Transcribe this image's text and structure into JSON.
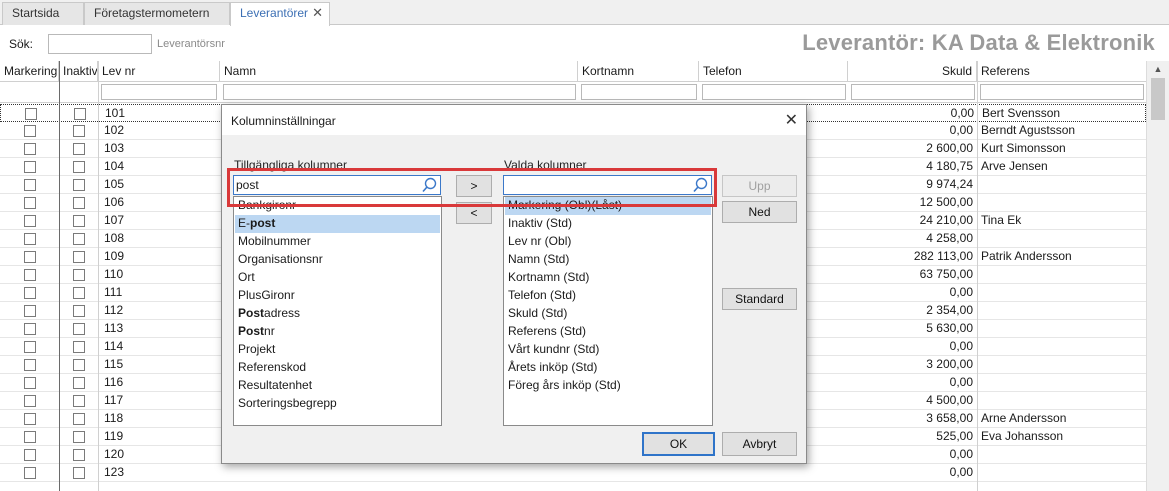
{
  "tabs": [
    {
      "label": "Startsida"
    },
    {
      "label": "Företagstermometern"
    },
    {
      "label": "Leverantörer"
    }
  ],
  "toolbar": {
    "search_label": "Sök:",
    "search_value": "",
    "search_hint": "Leverantörsnr",
    "title": "Leverantör: KA Data & Elektronik"
  },
  "grid": {
    "columns": [
      "Markering",
      "Inaktiv",
      "Lev nr",
      "Namn",
      "Kortnamn",
      "Telefon",
      "Skuld",
      "Referens"
    ],
    "rows": [
      {
        "nr": "101",
        "skuld": "0,00",
        "ref": "Bert Svensson"
      },
      {
        "nr": "102",
        "skuld": "0,00",
        "ref": "Berndt Agustsson"
      },
      {
        "nr": "103",
        "skuld": "2 600,00",
        "ref": "Kurt Simonsson"
      },
      {
        "nr": "104",
        "skuld": "4 180,75",
        "ref": "Arve Jensen"
      },
      {
        "nr": "105",
        "skuld": "9 974,24",
        "ref": ""
      },
      {
        "nr": "106",
        "skuld": "12 500,00",
        "ref": ""
      },
      {
        "nr": "107",
        "skuld": "24 210,00",
        "ref": "Tina Ek"
      },
      {
        "nr": "108",
        "skuld": "4 258,00",
        "ref": ""
      },
      {
        "nr": "109",
        "skuld": "282 113,00",
        "ref": "Patrik Andersson"
      },
      {
        "nr": "110",
        "skuld": "63 750,00",
        "ref": ""
      },
      {
        "nr": "111",
        "skuld": "0,00",
        "ref": ""
      },
      {
        "nr": "112",
        "skuld": "2 354,00",
        "ref": ""
      },
      {
        "nr": "113",
        "skuld": "5 630,00",
        "ref": ""
      },
      {
        "nr": "114",
        "skuld": "0,00",
        "ref": ""
      },
      {
        "nr": "115",
        "skuld": "3 200,00",
        "ref": ""
      },
      {
        "nr": "116",
        "skuld": "0,00",
        "ref": ""
      },
      {
        "nr": "117",
        "skuld": "4 500,00",
        "ref": ""
      },
      {
        "nr": "118",
        "skuld": "3 658,00",
        "ref": "Arne Andersson"
      },
      {
        "nr": "119",
        "skuld": "525,00",
        "ref": "Eva Johansson"
      },
      {
        "nr": "120",
        "skuld": "0,00",
        "ref": ""
      },
      {
        "nr": "123",
        "skuld": "0,00",
        "ref": ""
      }
    ]
  },
  "dialog": {
    "title": "Kolumninställningar",
    "available_label": "Tillgängliga kolumner",
    "available_search": "post",
    "selected_label": "Valda kolumner",
    "selected_search": "",
    "available": [
      {
        "pre": "Bankgironr",
        "bold": "",
        "post": ""
      },
      {
        "pre": "E-",
        "bold": "post",
        "post": ""
      },
      {
        "pre": "Mobilnummer",
        "bold": "",
        "post": ""
      },
      {
        "pre": "Organisationsnr",
        "bold": "",
        "post": ""
      },
      {
        "pre": "Ort",
        "bold": "",
        "post": ""
      },
      {
        "pre": "PlusGironr",
        "bold": "",
        "post": ""
      },
      {
        "pre": "",
        "bold": "Post",
        "post": "adress"
      },
      {
        "pre": "",
        "bold": "Post",
        "post": "nr"
      },
      {
        "pre": "Projekt",
        "bold": "",
        "post": ""
      },
      {
        "pre": "Referenskod",
        "bold": "",
        "post": ""
      },
      {
        "pre": "Resultatenhet",
        "bold": "",
        "post": ""
      },
      {
        "pre": "Sorteringsbegrepp",
        "bold": "",
        "post": ""
      }
    ],
    "selected": [
      "Markering (Obl)(Låst)",
      "Inaktiv (Std)",
      "Lev nr (Obl)",
      "Namn (Std)",
      "Kortnamn (Std)",
      "Telefon (Std)",
      "Skuld (Std)",
      "Referens (Std)",
      "Vårt kundnr (Std)",
      "Årets inköp (Std)",
      "Föreg års inköp (Std)"
    ],
    "buttons": {
      "add": ">",
      "remove": "<",
      "up": "Upp",
      "down": "Ned",
      "standard": "Standard",
      "ok": "OK",
      "cancel": "Avbryt"
    }
  },
  "colors": {
    "accent": "#3c6fb4",
    "selection": "#bcd7f2",
    "highlight": "#d9393a"
  }
}
